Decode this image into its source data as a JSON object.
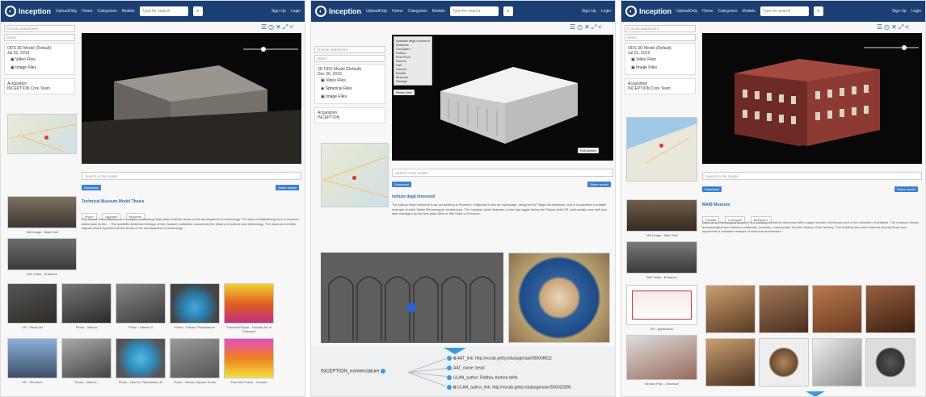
{
  "nav": {
    "brand": "Inception",
    "links": [
      "UploadOnly",
      "Home",
      "Categories",
      "Models"
    ],
    "search_placeholder": "Type for search",
    "signup": "Sign Up",
    "login": "Login"
  },
  "panel1": {
    "sidebar": {
      "annotation_placeholder": "Choose attachment",
      "select_value": "Select",
      "model_name": "ODS 3D Model (Default)",
      "model_date": "Jul 01, 2019",
      "video_files": "Video Files",
      "image_files": "Image Files",
      "acquisition": "Acquisition",
      "team": "INCEPTION Core Team"
    },
    "search_placeholder": "Search in the model",
    "btn_left": "Download",
    "btn_right": "Share model",
    "title": "Technical Museum Model Thesis",
    "tags": [
      "Room",
      "Upgrade",
      "Museum"
    ],
    "description": "The Nikola Tesla Museum is a complex of buildings that present all the areas of the development of technology. The idea of establishing such a museum dates back to the ... The scientific-technical heritage of the museum collection documents the history of science and technology. The museum exhibits objects which represent all the areas of the development of technology...",
    "thumbs": [
      {
        "caption": "360 Image - Main Hall"
      },
      {
        "caption": "360 Video - Entrance"
      },
      {
        "caption": "VR - Radio Art"
      },
      {
        "caption": "Photo - Interior"
      },
      {
        "caption": "Photo - Interior II"
      },
      {
        "caption": "Photo - Interior, Planetarium"
      },
      {
        "caption": "Thermal Picture - Facade Art of Entrance"
      },
      {
        "caption": "VR - Structure"
      },
      {
        "caption": "Photo - Interior I"
      },
      {
        "caption": "Photo - Interior, Planetarium III"
      },
      {
        "caption": "Photo - Interior Square Room"
      },
      {
        "caption": "Thermal Picture - Facade"
      }
    ]
  },
  "panel2": {
    "sidebar": {
      "annotation_placeholder": "Choose attachment",
      "select_value": "Select",
      "model_name": "3D ODS Model (Default)",
      "model_date": "Dec 20, 2019",
      "video_files": "Video Files",
      "spherical_files": "Spherical Files",
      "image_files": "Image Files",
      "acquisition": "Acquisition",
      "team": "INCEPTION"
    },
    "menu": [
      "Spedale degli Innocenti",
      "Entrance",
      "Courtyard",
      "Portico",
      "First Floor",
      "Rooms",
      "Hall",
      "Church",
      "Exhibit",
      "Museum",
      "Storage"
    ],
    "viewer_btn": "Reset view",
    "viewer_btn2": "Full screen",
    "search_placeholder": "Search in the model",
    "btn_left": "Download",
    "btn_right": "Share model",
    "title": "Istituto degli Innocenti",
    "description": "The Istituto degli Innocenti is an old building in Florence. Originally it was an orphanage, designed by Filippo Brunelleschi, and is considered a notable example of early Italian Renaissance architecture. The hospital, which features a nine bay loggia facing the Piazza della SS. Annunziata, was built and later managed by the Arte della Seta or Silk Guild of Florence...",
    "graph": {
      "center": "INCEPTION_nomenclature",
      "items": [
        "AAT_link: http://vocab.getty.edu/page/aat/300008622",
        "AAT_name: bead",
        "ULAN_author: Robbia, Andrea della",
        "ULAN_author_link: http://vocab.getty.edu/page/ulan/500022895"
      ]
    }
  },
  "panel3": {
    "sidebar": {
      "annotation_placeholder": "Choose attachment",
      "select_value": "Select",
      "model_name": "ODS 3D Model (Default)",
      "model_date": "Jul 01, 2019",
      "video_files": "Video Files",
      "image_files": "Image Files",
      "acquisition": "Acquisition",
      "team": "INCEPTION Core Team"
    },
    "search_placeholder": "Search in the model",
    "btn_left": "Download",
    "btn_right": "Share model",
    "title": "MAIB Museum",
    "tags": [
      "Facade",
      "Courtyard",
      "Behaviour"
    ],
    "description": "National Archaeological Museum is a building of historic relevance with a large number of frescoes and a rich collection of artifacts. The museum shows archaeological and historical materials, artworks, manuscripts, and the history of the territory. The building has been restored several times and represents a valuable example of historical architecture...",
    "thumbs": [
      {
        "caption": "360 Image - Main Hall"
      },
      {
        "caption": "360 Video - Entrance"
      },
      {
        "caption": "VR - Application"
      },
      {
        "caption": "Section Plan - Structure"
      }
    ]
  }
}
